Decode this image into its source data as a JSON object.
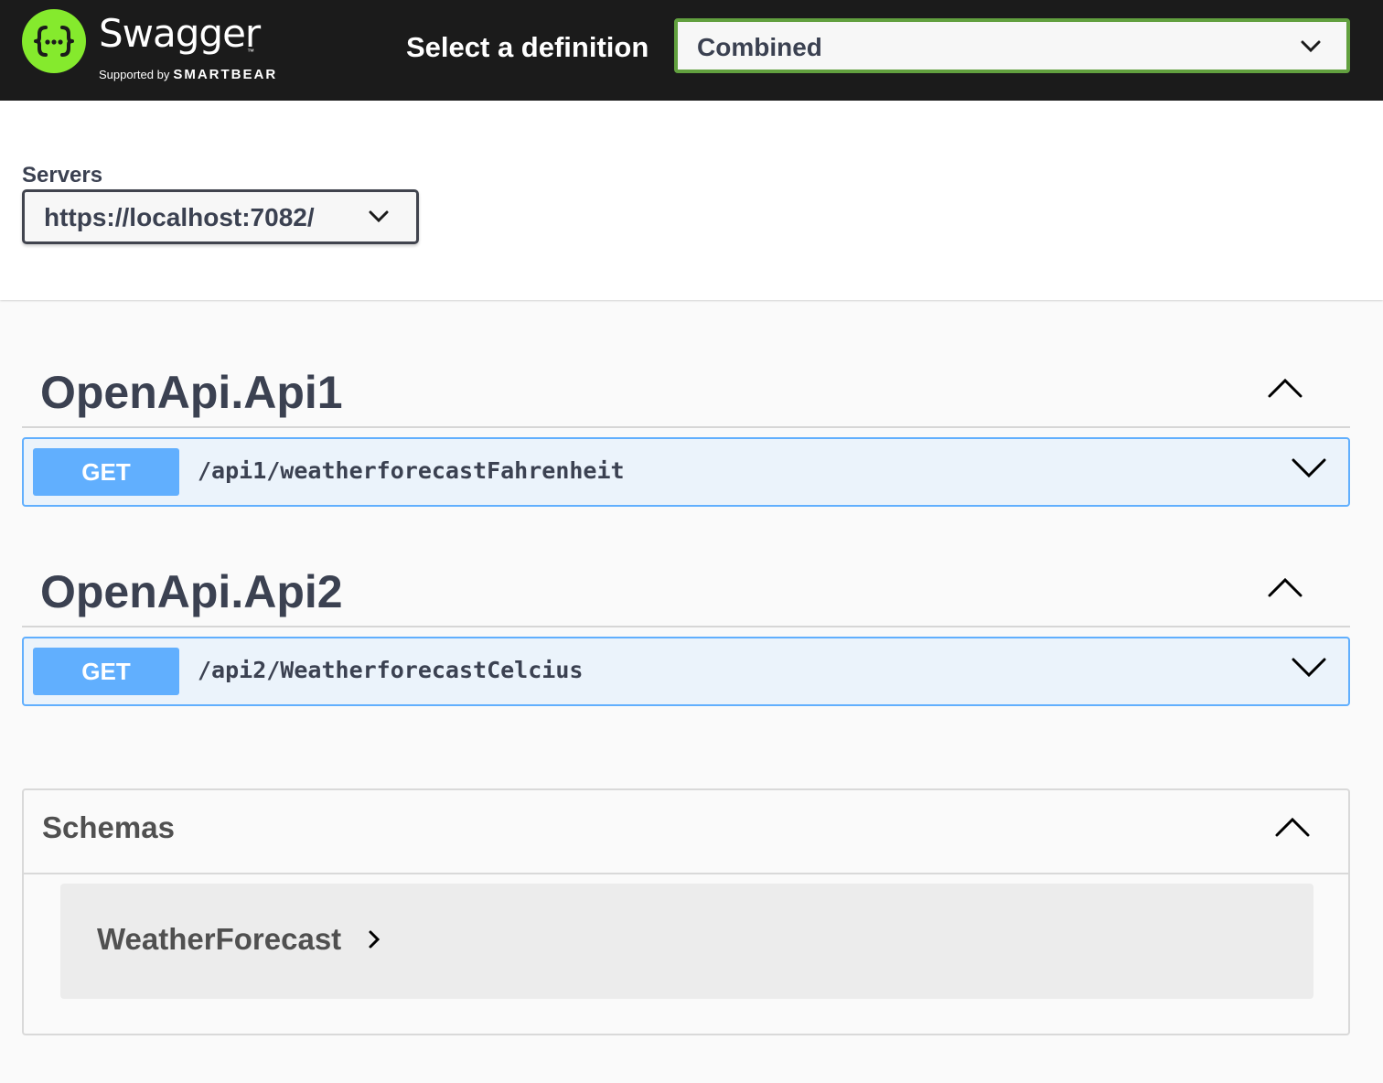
{
  "topbar": {
    "brand": {
      "name": "Swagger",
      "tm": "™",
      "supported_by": "Supported by",
      "company": "SMARTBEAR"
    },
    "definition_label": "Select a definition",
    "definition_value": "Combined",
    "logo_color": "#85ea2d",
    "select_border_color": "#62a03f"
  },
  "servers": {
    "label": "Servers",
    "value": "https://localhost:7082/"
  },
  "tags": [
    {
      "name": "OpenApi.Api1",
      "operations": [
        {
          "method": "GET",
          "path": "/api1/weatherforecastFahrenheit"
        }
      ]
    },
    {
      "name": "OpenApi.Api2",
      "operations": [
        {
          "method": "GET",
          "path": "/api2/WeatherforecastCelcius"
        }
      ]
    }
  ],
  "schemas": {
    "title": "Schemas",
    "models": [
      "WeatherForecast"
    ]
  },
  "colors": {
    "get_method": "#61affe",
    "get_bg": "#ebf3fb",
    "text": "#3b4151"
  },
  "icons": {
    "logo": "swagger-braces-icon",
    "dropdown": "chevron-down-icon",
    "collapse": "chevron-up-icon",
    "expand_op": "chevron-down-icon",
    "model_expand": "chevron-right-icon"
  }
}
